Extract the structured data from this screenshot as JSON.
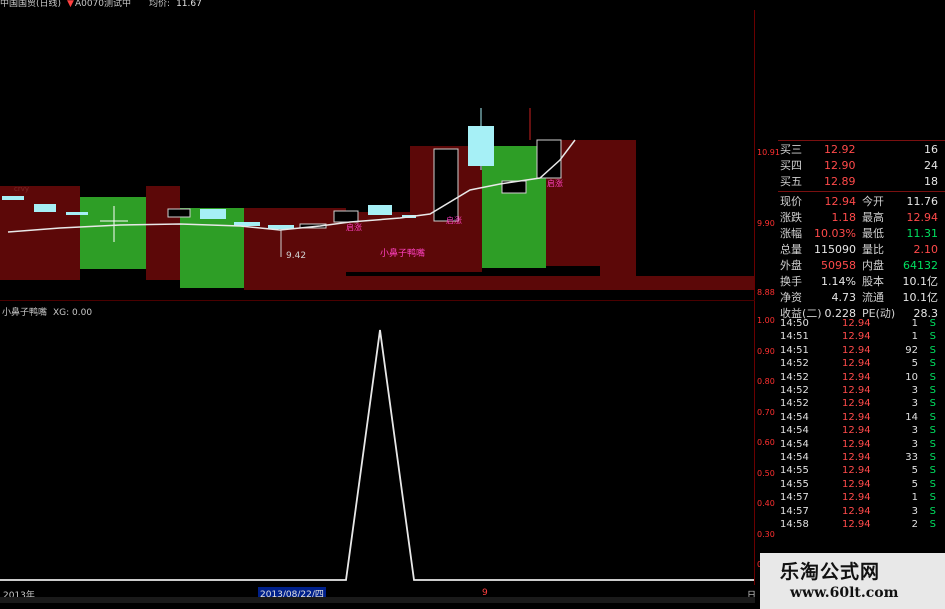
{
  "header": {
    "title": "中国国贸(日线)",
    "mark": "▼",
    "status": "A0070测试中",
    "avg_label": "均价:",
    "avg_value": "11.67"
  },
  "main_chart": {
    "labels": {
      "low_price": "9.42",
      "pattern": "小鼻子鸭嘴",
      "gap1": "启涨",
      "gap2": "启涨",
      "gap3": "启涨"
    },
    "price_axis": [
      "10.91",
      "9.90",
      "8.88"
    ]
  },
  "indicator": {
    "name": "小鼻子鸭嘴",
    "value_label": "XG: 0.00",
    "axis": [
      "1.00",
      "0.90",
      "0.80",
      "0.70",
      "0.60",
      "0.50",
      "0.40",
      "0.30",
      "0.20"
    ],
    "chart_data": {
      "type": "line",
      "series": [
        {
          "name": "XG",
          "values": [
            0,
            0,
            0,
            0,
            0,
            1,
            0,
            0,
            0,
            0,
            0,
            0
          ]
        }
      ],
      "ylim": [
        0,
        1
      ]
    }
  },
  "bottom_axis": {
    "year": "2013年",
    "date": "2013/08/22/四",
    "tick": "9",
    "day": "日"
  },
  "quote": {
    "bids": [
      {
        "label": "买三",
        "price": "12.92",
        "vol": "16"
      },
      {
        "label": "买四",
        "price": "12.90",
        "vol": "24"
      },
      {
        "label": "买五",
        "price": "12.89",
        "vol": "18"
      }
    ],
    "stats": [
      {
        "l1": "现价",
        "v1": "12.94",
        "l2": "今开",
        "v2": "11.76",
        "c1": "red",
        "c2": "wht"
      },
      {
        "l1": "涨跌",
        "v1": "1.18",
        "l2": "最高",
        "v2": "12.94",
        "c1": "red",
        "c2": "red"
      },
      {
        "l1": "涨幅",
        "v1": "10.03%",
        "l2": "最低",
        "v2": "11.31",
        "c1": "red",
        "c2": "grn"
      },
      {
        "l1": "总量",
        "v1": "115090",
        "l2": "量比",
        "v2": "2.10",
        "c1": "wht",
        "c2": "red"
      },
      {
        "l1": "外盘",
        "v1": "50958",
        "l2": "内盘",
        "v2": "64132",
        "c1": "red",
        "c2": "grn"
      },
      {
        "l1": "换手",
        "v1": "1.14%",
        "l2": "股本",
        "v2": "10.1亿",
        "c1": "wht",
        "c2": "wht"
      },
      {
        "l1": "净资",
        "v1": "4.73",
        "l2": "流通",
        "v2": "10.1亿",
        "c1": "wht",
        "c2": "wht"
      },
      {
        "l1": "收益(二)",
        "v1": "0.228",
        "l2": "PE(动)",
        "v2": "28.3",
        "c1": "wht",
        "c2": "wht"
      }
    ],
    "trades": [
      {
        "time": "14:50",
        "price": "12.94",
        "vol": "1",
        "side": "S"
      },
      {
        "time": "14:51",
        "price": "12.94",
        "vol": "1",
        "side": "S"
      },
      {
        "time": "14:51",
        "price": "12.94",
        "vol": "92",
        "side": "S"
      },
      {
        "time": "14:52",
        "price": "12.94",
        "vol": "5",
        "side": "S"
      },
      {
        "time": "14:52",
        "price": "12.94",
        "vol": "10",
        "side": "S"
      },
      {
        "time": "14:52",
        "price": "12.94",
        "vol": "3",
        "side": "S"
      },
      {
        "time": "14:52",
        "price": "12.94",
        "vol": "3",
        "side": "S"
      },
      {
        "time": "14:54",
        "price": "12.94",
        "vol": "14",
        "side": "S"
      },
      {
        "time": "14:54",
        "price": "12.94",
        "vol": "3",
        "side": "S"
      },
      {
        "time": "14:54",
        "price": "12.94",
        "vol": "3",
        "side": "S"
      },
      {
        "time": "14:54",
        "price": "12.94",
        "vol": "33",
        "side": "S"
      },
      {
        "time": "14:55",
        "price": "12.94",
        "vol": "5",
        "side": "S"
      },
      {
        "time": "14:55",
        "price": "12.94",
        "vol": "5",
        "side": "S"
      },
      {
        "time": "14:57",
        "price": "12.94",
        "vol": "1",
        "side": "S"
      },
      {
        "time": "14:57",
        "price": "12.94",
        "vol": "3",
        "side": "S"
      },
      {
        "time": "14:58",
        "price": "12.94",
        "vol": "2",
        "side": "S"
      }
    ]
  },
  "watermark": {
    "title": "乐淘公式网",
    "url": "www.60lt.com"
  }
}
